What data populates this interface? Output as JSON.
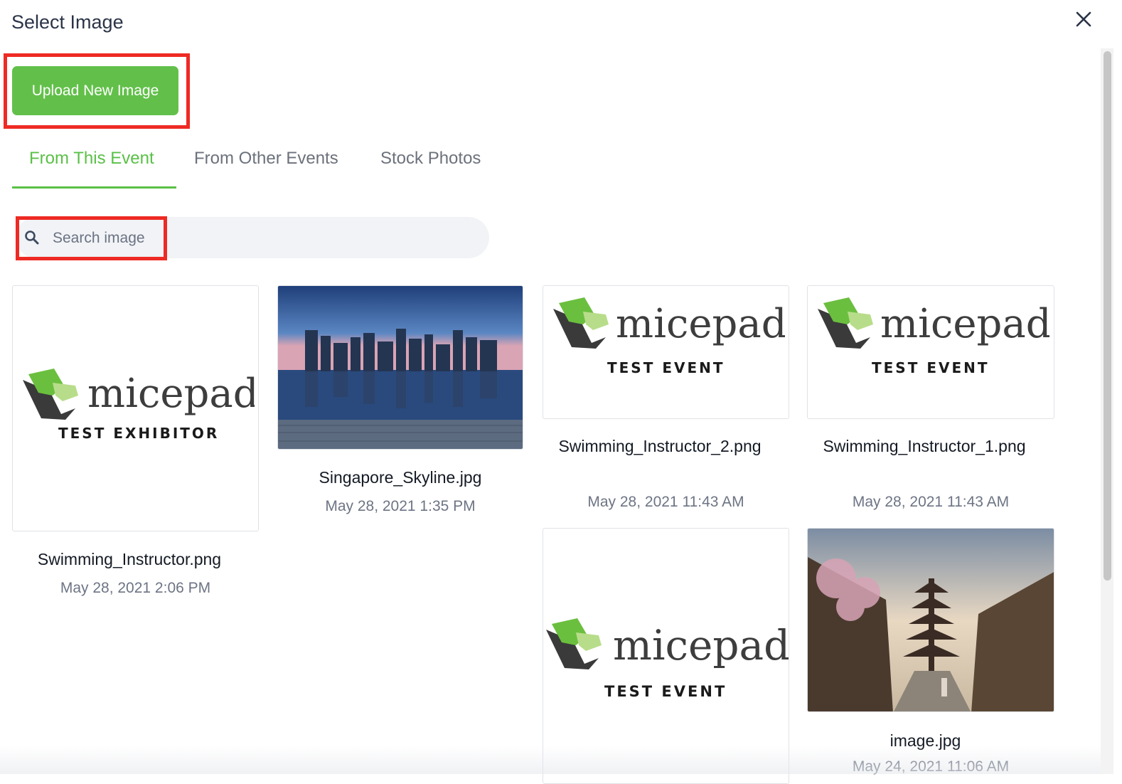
{
  "dialog": {
    "title": "Select Image"
  },
  "upload_button": {
    "label": "Upload New Image"
  },
  "tabs": [
    {
      "label": "From This Event",
      "active": true
    },
    {
      "label": "From Other Events",
      "active": false
    },
    {
      "label": "Stock Photos",
      "active": false
    }
  ],
  "search": {
    "placeholder": "Search image",
    "value": ""
  },
  "images": [
    {
      "name": "Swimming_Instructor.png",
      "date": "May 28, 2021 2:06 PM",
      "logo_word": "micepad",
      "logo_sub": "TEST EXHIBITOR"
    },
    {
      "name": "Singapore_Skyline.jpg",
      "date": "May 28, 2021 1:35 PM"
    },
    {
      "name": "Swimming_Instructor_2.png",
      "date": "May 28, 2021 11:43 AM",
      "logo_word": "micepad",
      "logo_sub": "TEST EVENT"
    },
    {
      "name": "Swimming_Instructor_1.png",
      "date": "May 28, 2021 11:43 AM",
      "logo_word": "micepad",
      "logo_sub": "TEST EVENT"
    },
    {
      "name": "",
      "date": "",
      "logo_word": "micepad",
      "logo_sub": "TEST EVENT"
    },
    {
      "name": "image.jpg",
      "date": "May 24, 2021 11:06 AM"
    }
  ],
  "colors": {
    "accent": "#5ac047",
    "upload": "#62c04a",
    "highlight": "#ee2a24"
  },
  "icons": {
    "close": "close-icon",
    "search": "search-icon"
  }
}
